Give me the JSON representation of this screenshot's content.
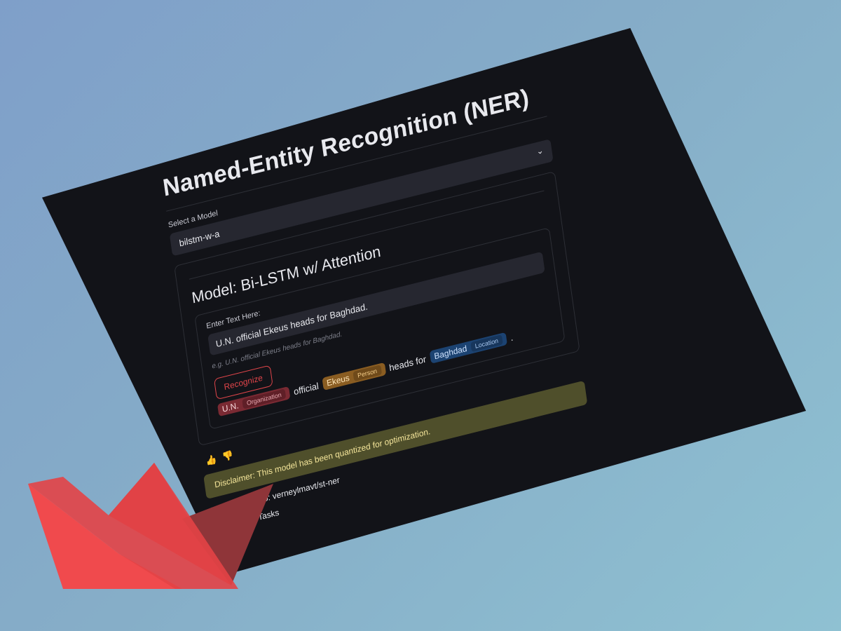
{
  "app": {
    "title": "Named-Entity Recognition (NER)",
    "select_model_label": "Select a Model",
    "selected_model": "bilstm-w-a",
    "model_heading": "Model: Bi-LSTM w/ Attention",
    "input_label": "Enter Text Here:",
    "input_value": "U.N. official Ekeus heads for Baghdad.",
    "input_hint": "e.g. U.N. official Ekeus heads for Baghdad.",
    "recognize_label": "Recognize",
    "result": {
      "tokens": [
        {
          "text": "U.N.",
          "label": "Organization",
          "type": "org"
        },
        {
          "text": "official"
        },
        {
          "text": "Ekeus",
          "label": "Person",
          "type": "per"
        },
        {
          "text": "heads for"
        },
        {
          "text": "Baghdad",
          "label": "Location",
          "type": "loc"
        },
        {
          "text": "."
        }
      ]
    },
    "feedback": {
      "thumbs_up_icon": "thumbs-up-icon",
      "thumbs_down_icon": "thumbs-down-icon"
    },
    "disclaimer": "Disclaimer: This model has been quantized for optimization.",
    "footer": {
      "github_text": "GitHub Repo: verneylmavt/st-ner",
      "other_tasks_text": "Other ML Tasks"
    }
  },
  "colors": {
    "accent": "#e0454a",
    "org": "#7a2a33",
    "person": "#8a5d22",
    "location": "#1c4372",
    "disclaimer_bg": "#4f4f2b"
  },
  "logo": {
    "icon": "paper-boat-logo",
    "colors": [
      "#f04a4d",
      "#c94347",
      "#8f3539"
    ]
  }
}
